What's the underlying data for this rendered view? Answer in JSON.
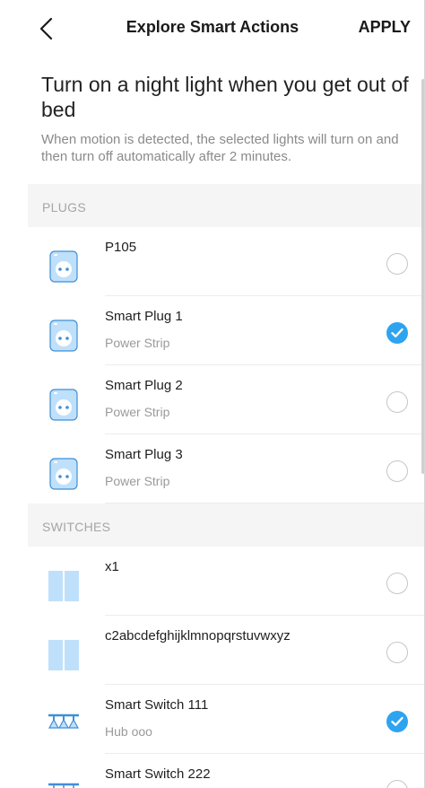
{
  "header": {
    "title": "Explore Smart Actions",
    "apply_label": "APPLY",
    "back_icon": "chevron-left-icon"
  },
  "action": {
    "title": "Turn on a night light when you get out of bed",
    "description": "When motion is detected, the selected lights will turn on and then turn off automatically after 2 minutes."
  },
  "sections": [
    {
      "label": "PLUGS",
      "items": [
        {
          "name": "P105",
          "sub": "",
          "icon": "plug-icon",
          "selected": false
        },
        {
          "name": "Smart Plug 1",
          "sub": "Power Strip",
          "icon": "plug-icon",
          "selected": true
        },
        {
          "name": "Smart Plug 2",
          "sub": "Power Strip",
          "icon": "plug-icon",
          "selected": false
        },
        {
          "name": "Smart Plug 3",
          "sub": "Power Strip",
          "icon": "plug-icon",
          "selected": false
        }
      ]
    },
    {
      "label": "SWITCHES",
      "items": [
        {
          "name": "x1",
          "sub": "",
          "icon": "wall-switch-icon",
          "selected": false
        },
        {
          "name": "c2abcdefghijklmnopqrstuvwxyz",
          "sub": "",
          "icon": "wall-switch-icon",
          "selected": false
        },
        {
          "name": "Smart Switch 111",
          "sub": "Hub ooo",
          "icon": "light-switch-icon",
          "selected": true
        },
        {
          "name": "Smart Switch 222",
          "sub": "",
          "icon": "light-switch-outline-icon",
          "selected": false
        }
      ]
    }
  ],
  "colors": {
    "accent": "#2ea4f0",
    "icon_fill": "#bfe0fb",
    "icon_stroke": "#3f8fd6",
    "section_bg": "#f5f5f5"
  }
}
